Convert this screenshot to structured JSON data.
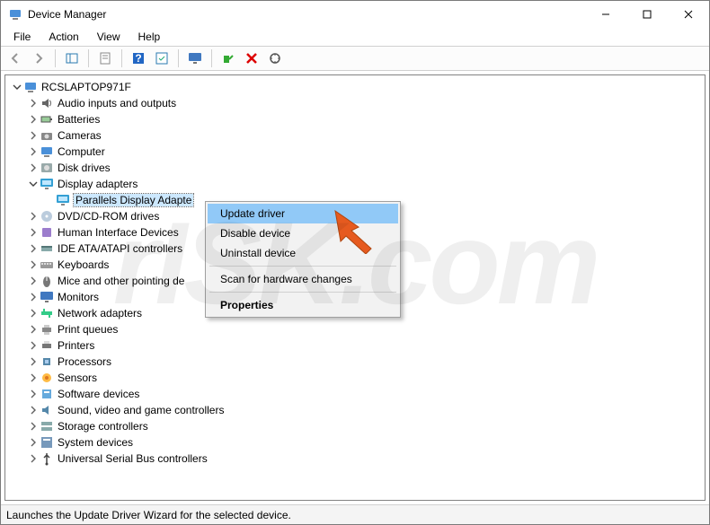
{
  "titlebar": {
    "title": "Device Manager"
  },
  "menubar": {
    "items": [
      "File",
      "Action",
      "View",
      "Help"
    ]
  },
  "root_node": "RCSLAPTOP971F",
  "categories": [
    {
      "label": "Audio inputs and outputs",
      "icon": "speaker",
      "expanded": false
    },
    {
      "label": "Batteries",
      "icon": "battery",
      "expanded": false
    },
    {
      "label": "Cameras",
      "icon": "camera",
      "expanded": false
    },
    {
      "label": "Computer",
      "icon": "computer",
      "expanded": false
    },
    {
      "label": "Disk drives",
      "icon": "disk",
      "expanded": false
    },
    {
      "label": "Display adapters",
      "icon": "display",
      "expanded": true,
      "children": [
        {
          "label": "Parallels Display Adapte",
          "icon": "display",
          "selected": true
        }
      ]
    },
    {
      "label": "DVD/CD-ROM drives",
      "icon": "dvd",
      "expanded": false
    },
    {
      "label": "Human Interface Devices",
      "icon": "hid",
      "expanded": false
    },
    {
      "label": "IDE ATA/ATAPI controllers",
      "icon": "ide",
      "expanded": false
    },
    {
      "label": "Keyboards",
      "icon": "keyboard",
      "expanded": false
    },
    {
      "label": "Mice and other pointing de",
      "icon": "mouse",
      "expanded": false
    },
    {
      "label": "Monitors",
      "icon": "monitor",
      "expanded": false
    },
    {
      "label": "Network adapters",
      "icon": "network",
      "expanded": false
    },
    {
      "label": "Print queues",
      "icon": "print",
      "expanded": false
    },
    {
      "label": "Printers",
      "icon": "printer",
      "expanded": false
    },
    {
      "label": "Processors",
      "icon": "cpu",
      "expanded": false
    },
    {
      "label": "Sensors",
      "icon": "sensor",
      "expanded": false
    },
    {
      "label": "Software devices",
      "icon": "soft",
      "expanded": false
    },
    {
      "label": "Sound, video and game controllers",
      "icon": "sound",
      "expanded": false
    },
    {
      "label": "Storage controllers",
      "icon": "storage",
      "expanded": false
    },
    {
      "label": "System devices",
      "icon": "system",
      "expanded": false
    },
    {
      "label": "Universal Serial Bus controllers",
      "icon": "usb",
      "expanded": false
    }
  ],
  "context_menu": {
    "update": "Update driver",
    "disable": "Disable device",
    "uninstall": "Uninstall device",
    "scan": "Scan for hardware changes",
    "properties": "Properties"
  },
  "statusbar": {
    "text": "Launches the Update Driver Wizard for the selected device."
  },
  "watermark": "rISK.com"
}
